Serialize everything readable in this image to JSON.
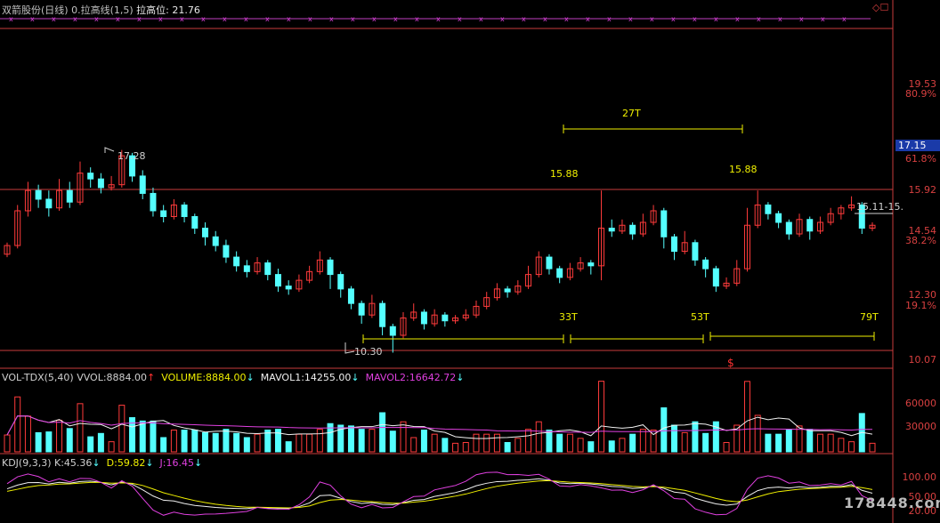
{
  "header": {
    "stock": "双箭股份(日线)",
    "indicator": "0.拉高线(1,5)",
    "level_label": "拉高位:",
    "level_value": "21.76"
  },
  "price_axis": {
    "ticks": [
      {
        "value": "19.53",
        "pct": "80.9%"
      },
      {
        "value": "15.92",
        "pct": "61.8%"
      },
      {
        "value": "14.54",
        "pct": "38.2%"
      },
      {
        "value": "12.30",
        "pct": "19.1%"
      },
      {
        "value": "10.07",
        "pct": ""
      }
    ],
    "current_price": "17.15"
  },
  "annotations": {
    "high_left": "17.28",
    "low": "10.30",
    "peak1": "15.88",
    "peak2": "15.88",
    "range_label": "15.11-15.",
    "span_top": "27T",
    "span_a": "33T",
    "span_b": "53T",
    "span_c": "79T"
  },
  "volume_panel": {
    "title": "VOL-TDX(5,40)",
    "vvol_label": "VVOL:",
    "vvol": "8884.00",
    "volume_label": "VOLUME:",
    "volume": "8884.00",
    "mavol1_label": "MAVOL1:",
    "mavol1": "14255.00",
    "mavol2_label": "MAVOL2:",
    "mavol2": "16642.72",
    "ticks": [
      "60000",
      "30000"
    ]
  },
  "kdj_panel": {
    "title": "KDJ(9,3,3)",
    "k_label": "K:",
    "k": "45.36",
    "d_label": "D:",
    "d": "59.82",
    "j_label": "J:",
    "j": "16.45",
    "ticks": [
      "100.00",
      "50.00",
      "20.00"
    ]
  },
  "watermark": "178448.com",
  "colors": {
    "up": "#ff3b3b",
    "down": "#54ffff",
    "ma": "#f0f000",
    "ma2": "#e040e0",
    "axis": "#c83c3c"
  },
  "chart_data": {
    "type": "candlestick",
    "candles": [
      [
        13.7,
        14.0,
        14.1,
        13.6
      ],
      [
        14.0,
        15.2,
        15.4,
        13.9
      ],
      [
        15.2,
        15.9,
        16.2,
        15.0
      ],
      [
        15.9,
        15.6,
        16.1,
        15.3
      ],
      [
        15.6,
        15.3,
        15.9,
        15.0
      ],
      [
        15.3,
        15.9,
        16.3,
        15.2
      ],
      [
        15.9,
        15.5,
        16.2,
        15.3
      ],
      [
        15.5,
        16.5,
        16.9,
        15.4
      ],
      [
        16.5,
        16.3,
        16.7,
        16.0
      ],
      [
        16.3,
        16.0,
        16.5,
        15.8
      ],
      [
        16.0,
        16.1,
        16.4,
        15.9
      ],
      [
        16.1,
        17.1,
        17.3,
        16.0
      ],
      [
        17.1,
        16.4,
        17.2,
        16.2
      ],
      [
        16.4,
        15.8,
        16.6,
        15.6
      ],
      [
        15.8,
        15.2,
        16.0,
        15.0
      ],
      [
        15.2,
        15.0,
        15.4,
        14.8
      ],
      [
        15.0,
        15.4,
        15.6,
        14.9
      ],
      [
        15.4,
        15.0,
        15.5,
        14.8
      ],
      [
        15.0,
        14.6,
        15.1,
        14.4
      ],
      [
        14.6,
        14.3,
        14.8,
        14.0
      ],
      [
        14.3,
        14.0,
        14.5,
        13.8
      ],
      [
        14.0,
        13.6,
        14.2,
        13.4
      ],
      [
        13.6,
        13.3,
        13.8,
        13.1
      ],
      [
        13.3,
        13.1,
        13.5,
        12.9
      ],
      [
        13.1,
        13.4,
        13.6,
        13.0
      ],
      [
        13.4,
        13.0,
        13.5,
        12.8
      ],
      [
        13.0,
        12.6,
        13.2,
        12.4
      ],
      [
        12.6,
        12.5,
        12.8,
        12.3
      ],
      [
        12.5,
        12.8,
        13.0,
        12.4
      ],
      [
        12.8,
        13.1,
        13.3,
        12.7
      ],
      [
        13.1,
        13.5,
        13.8,
        13.0
      ],
      [
        13.5,
        13.0,
        13.6,
        12.5
      ],
      [
        13.0,
        12.5,
        13.1,
        12.2
      ],
      [
        12.5,
        12.0,
        12.6,
        11.8
      ],
      [
        12.0,
        11.6,
        12.1,
        11.3
      ],
      [
        11.6,
        12.0,
        12.3,
        11.5
      ],
      [
        12.0,
        11.2,
        12.1,
        10.9
      ],
      [
        11.2,
        10.9,
        11.3,
        10.3
      ],
      [
        10.9,
        11.5,
        11.7,
        10.8
      ],
      [
        11.5,
        11.7,
        12.0,
        11.4
      ],
      [
        11.7,
        11.3,
        11.8,
        11.1
      ],
      [
        11.3,
        11.6,
        11.8,
        11.2
      ],
      [
        11.6,
        11.4,
        11.7,
        11.2
      ],
      [
        11.4,
        11.5,
        11.6,
        11.3
      ],
      [
        11.5,
        11.6,
        11.8,
        11.4
      ],
      [
        11.6,
        11.9,
        12.1,
        11.5
      ],
      [
        11.9,
        12.2,
        12.4,
        11.8
      ],
      [
        12.2,
        12.5,
        12.7,
        12.1
      ],
      [
        12.5,
        12.4,
        12.6,
        12.2
      ],
      [
        12.4,
        12.6,
        12.8,
        12.3
      ],
      [
        12.6,
        13.0,
        13.3,
        12.5
      ],
      [
        13.0,
        13.6,
        13.8,
        12.9
      ],
      [
        13.6,
        13.2,
        13.7,
        13.0
      ],
      [
        13.2,
        12.9,
        13.3,
        12.7
      ],
      [
        12.9,
        13.2,
        13.4,
        12.8
      ],
      [
        13.2,
        13.4,
        13.6,
        13.1
      ],
      [
        13.4,
        13.3,
        13.5,
        13.0
      ],
      [
        13.3,
        14.6,
        15.9,
        12.8
      ],
      [
        14.6,
        14.5,
        14.9,
        14.3
      ],
      [
        14.5,
        14.7,
        14.9,
        14.4
      ],
      [
        14.7,
        14.4,
        14.8,
        14.2
      ],
      [
        14.4,
        14.8,
        15.1,
        14.3
      ],
      [
        14.8,
        15.2,
        15.4,
        14.7
      ],
      [
        15.2,
        14.3,
        15.3,
        13.9
      ],
      [
        14.3,
        13.8,
        14.4,
        13.5
      ],
      [
        13.8,
        14.1,
        14.5,
        13.7
      ],
      [
        14.1,
        13.5,
        14.2,
        13.3
      ],
      [
        13.5,
        13.2,
        13.6,
        12.9
      ],
      [
        13.2,
        12.6,
        13.3,
        12.4
      ],
      [
        12.6,
        12.7,
        12.9,
        12.5
      ],
      [
        12.7,
        13.2,
        13.5,
        12.6
      ],
      [
        13.2,
        14.7,
        15.3,
        13.1
      ],
      [
        14.7,
        15.4,
        15.9,
        14.6
      ],
      [
        15.4,
        15.1,
        15.5,
        14.9
      ],
      [
        15.1,
        14.8,
        15.2,
        14.6
      ],
      [
        14.8,
        14.4,
        14.9,
        14.2
      ],
      [
        14.4,
        14.9,
        15.1,
        14.3
      ],
      [
        14.9,
        14.5,
        15.0,
        14.2
      ],
      [
        14.5,
        14.8,
        15.0,
        14.4
      ],
      [
        14.8,
        15.1,
        15.3,
        14.7
      ],
      [
        15.1,
        15.3,
        15.4,
        14.9
      ],
      [
        15.3,
        15.4,
        15.7,
        15.2
      ],
      [
        15.4,
        14.6,
        15.5,
        14.4
      ],
      [
        14.6,
        14.7,
        14.8,
        14.5
      ]
    ]
  }
}
